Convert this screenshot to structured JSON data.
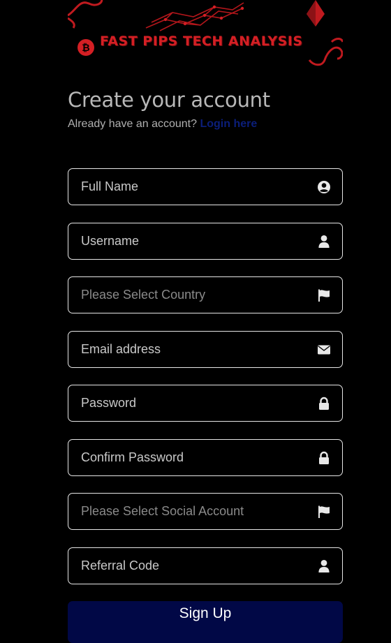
{
  "brand": {
    "name": "FAST PIPS TECH ANALYSIS"
  },
  "header": {
    "title": "Create your account",
    "subtitle": "Already have an account?",
    "login_link": "Login here"
  },
  "form": {
    "fields": [
      {
        "placeholder": "Full Name",
        "icon": "user-circle-icon"
      },
      {
        "placeholder": "Username",
        "icon": "user-icon"
      },
      {
        "placeholder": "Please Select Country",
        "icon": "flag-icon"
      },
      {
        "placeholder": "Email address",
        "icon": "envelope-icon"
      },
      {
        "placeholder": "Password",
        "icon": "lock-icon"
      },
      {
        "placeholder": "Confirm Password",
        "icon": "lock-icon"
      },
      {
        "placeholder": "Please Select Social Account",
        "icon": "flag-icon"
      },
      {
        "placeholder": "Referral Code",
        "icon": "user-icon"
      }
    ],
    "submit_label": "Sign Up"
  },
  "colors": {
    "background": "#000000",
    "brand_red": "#d41f24",
    "link": "#0b1e7a",
    "button": "#010846"
  }
}
